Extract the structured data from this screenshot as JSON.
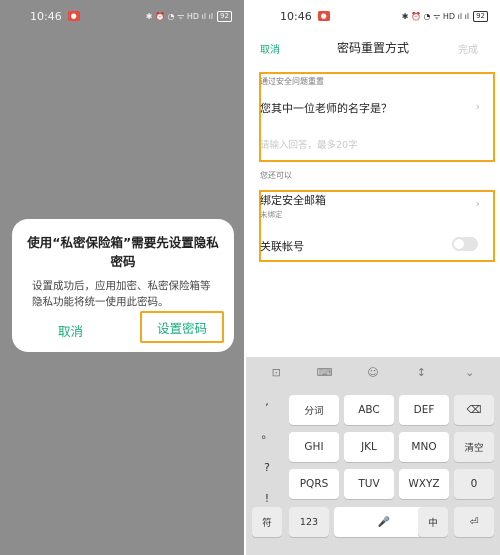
{
  "left": {
    "status": {
      "time": "10:46",
      "badge": "●",
      "icons": "✱ ⏰ ◔ ᯤ HD ıl ıl",
      "battery": "92"
    },
    "dialog": {
      "title": "使用“私密保险箱”需要先设置隐私密码",
      "message": "设置成功后，应用加密、私密保险箱等隐私功能将统一使用此密码。",
      "cancel_label": "取消",
      "confirm_label": "设置密码"
    }
  },
  "right": {
    "status": {
      "time": "10:46",
      "badge": "●",
      "icons": "✱ ⏰ ◔ ᯤ HD ıl ıl",
      "battery": "92"
    },
    "nav": {
      "cancel_label": "取消",
      "title": "密码重置方式",
      "done_label": "完成"
    },
    "security_section": {
      "label": "通过安全问题重置",
      "question": "您其中一位老师的名字是？",
      "answer_placeholder": "请输入回答，最多20字"
    },
    "alt_section": {
      "label": "您还可以",
      "email_label": "绑定安全邮箱",
      "email_status": "未绑定",
      "account_label": "关联帐号"
    },
    "keyboard": {
      "tools": [
        "⊡",
        "⌨",
        "☺",
        "↕",
        "⌄"
      ],
      "side": [
        ",",
        "。",
        "?",
        "!"
      ],
      "rows": [
        [
          "分词",
          "ABC",
          "DEF",
          "⌫"
        ],
        [
          "GHI",
          "JKL",
          "MNO",
          "清空"
        ],
        [
          "PQRS",
          "TUV",
          "WXYZ",
          "0"
        ]
      ],
      "bottom": {
        "symbol": "符",
        "num": "123",
        "space": "🎤",
        "lang": "中",
        "enter": "⏎"
      }
    }
  },
  "colors": {
    "accent": "#1aae7a",
    "highlight": "#f2a71f"
  }
}
